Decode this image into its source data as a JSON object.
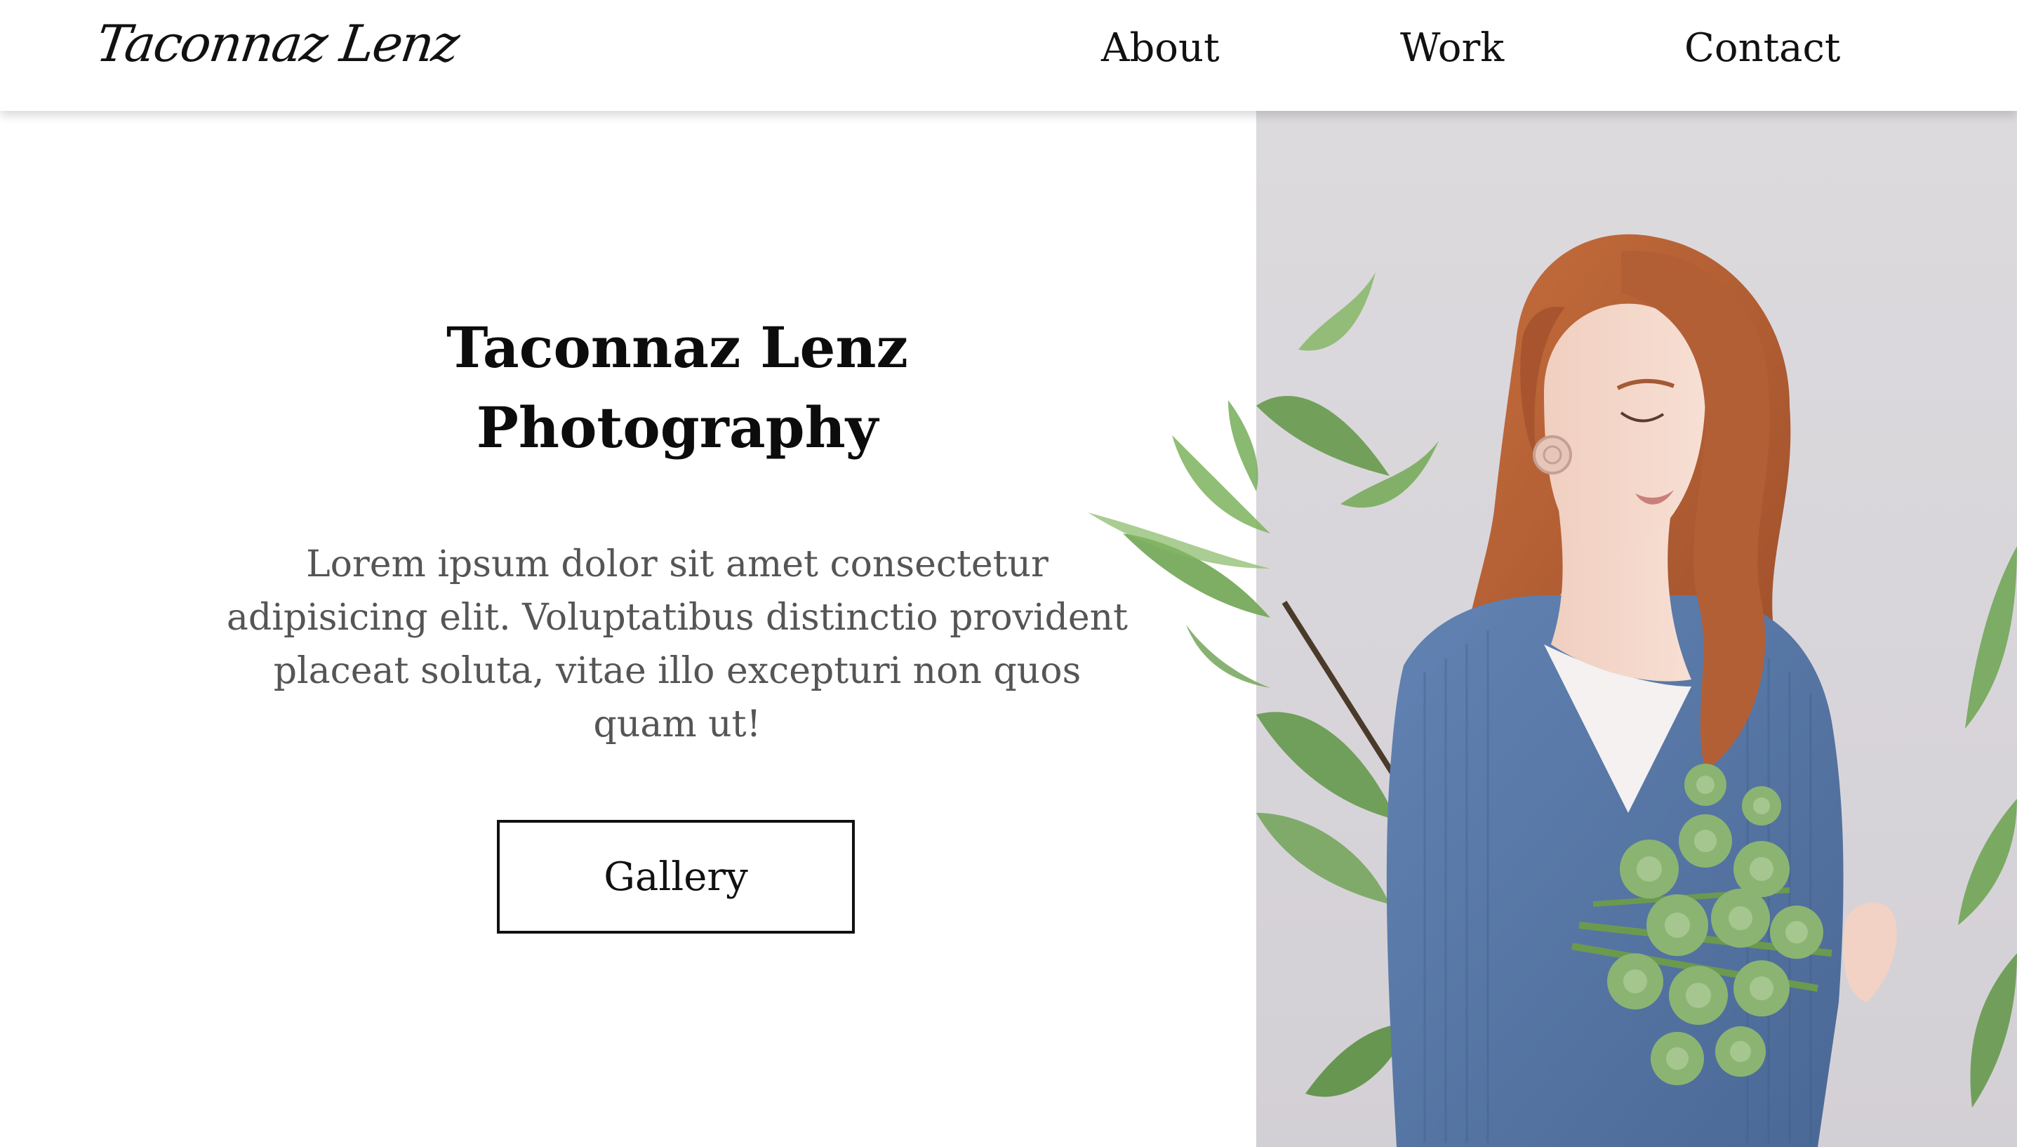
{
  "header": {
    "logo_text": "Taconnaz Lenz",
    "nav": [
      {
        "label": "About"
      },
      {
        "label": "Work"
      },
      {
        "label": "Contact"
      }
    ]
  },
  "hero": {
    "title_line1": "Taconnaz Lenz",
    "title_line2": "Photography",
    "description": "Lorem ipsum dolor sit amet consectetur adipisicing elit. Voluptatibus distinctio provident placeat soluta, vitae illo excepturi non quos quam ut!",
    "button_label": "Gallery"
  },
  "colors": {
    "background": "#ffffff",
    "text": "#111111",
    "muted_text": "#555555",
    "photo_backdrop": "#dcdadd",
    "hair": "#b8643a",
    "sweater": "#5574a4",
    "leaf": "#6fa552"
  }
}
